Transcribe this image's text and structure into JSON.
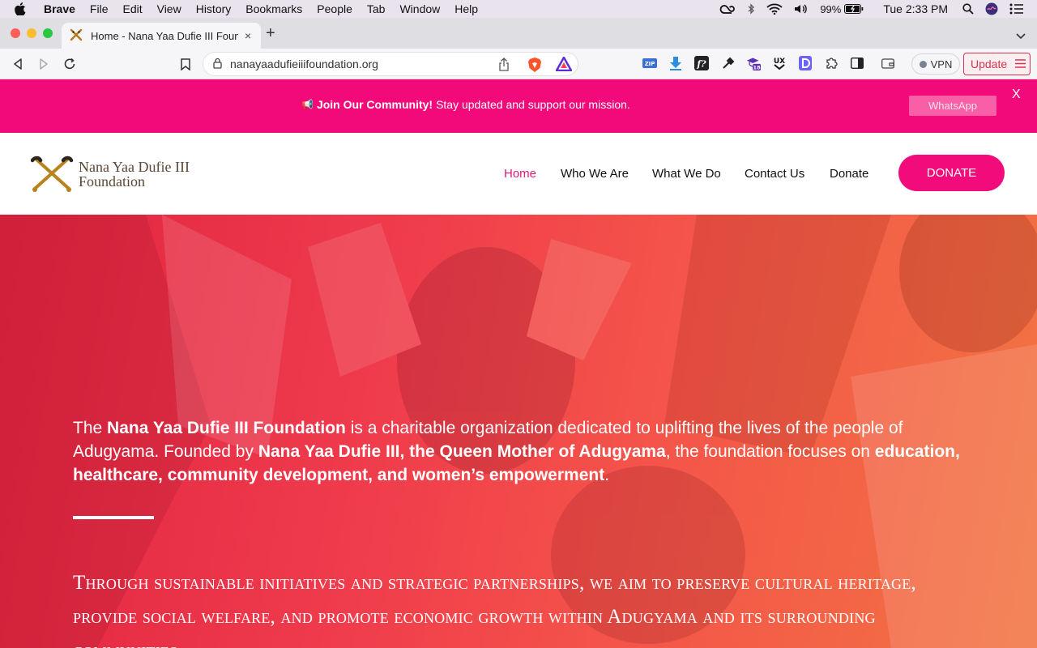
{
  "menubar": {
    "app": "Brave",
    "items": [
      "File",
      "Edit",
      "View",
      "History",
      "Bookmarks",
      "People",
      "Tab",
      "Window",
      "Help"
    ],
    "battery": "99%",
    "clock": "Tue 2:33 PM"
  },
  "tab": {
    "title": "Home - Nana Yaa Dufie III Foundation",
    "close": "×",
    "new_tab": "+"
  },
  "toolbar": {
    "url": "nanayaadufieiiifoundation.org",
    "vpn_label": "VPN",
    "update_label": "Update",
    "badge_count": "18"
  },
  "announcement": {
    "emoji": "📢",
    "bold": "Join Our Community!",
    "text": "Stay updated and support our mission.",
    "button": "WhatsApp",
    "close": "X"
  },
  "site": {
    "logo_line1": "Nana Yaa Dufie III",
    "logo_line2": "Foundation",
    "nav": [
      "Home",
      "Who We Are",
      "What We Do",
      "Contact Us",
      "Donate"
    ],
    "donate_button": "DONATE",
    "colors": {
      "brand": "#f20b7a",
      "nav_active": "#e0197a"
    }
  },
  "hero": {
    "p1_a": "The ",
    "p1_b": "Nana Yaa Dufie III Foundation",
    "p1_c": " is a charitable organization dedicated to uplifting the lives of the people of Adugyama. Founded by ",
    "p1_d": "Nana Yaa Dufie III, the Queen Mother of Adugyama",
    "p1_e": ", the foundation focuses on ",
    "p1_f": "education, healthcare, community development, and women’s empowerment",
    "p1_g": ".",
    "p2": "Through sustainable initiatives and strategic partnerships, we aim to preserve cultural heritage, provide social welfare, and promote economic growth within Adugyama and its surrounding communities."
  }
}
